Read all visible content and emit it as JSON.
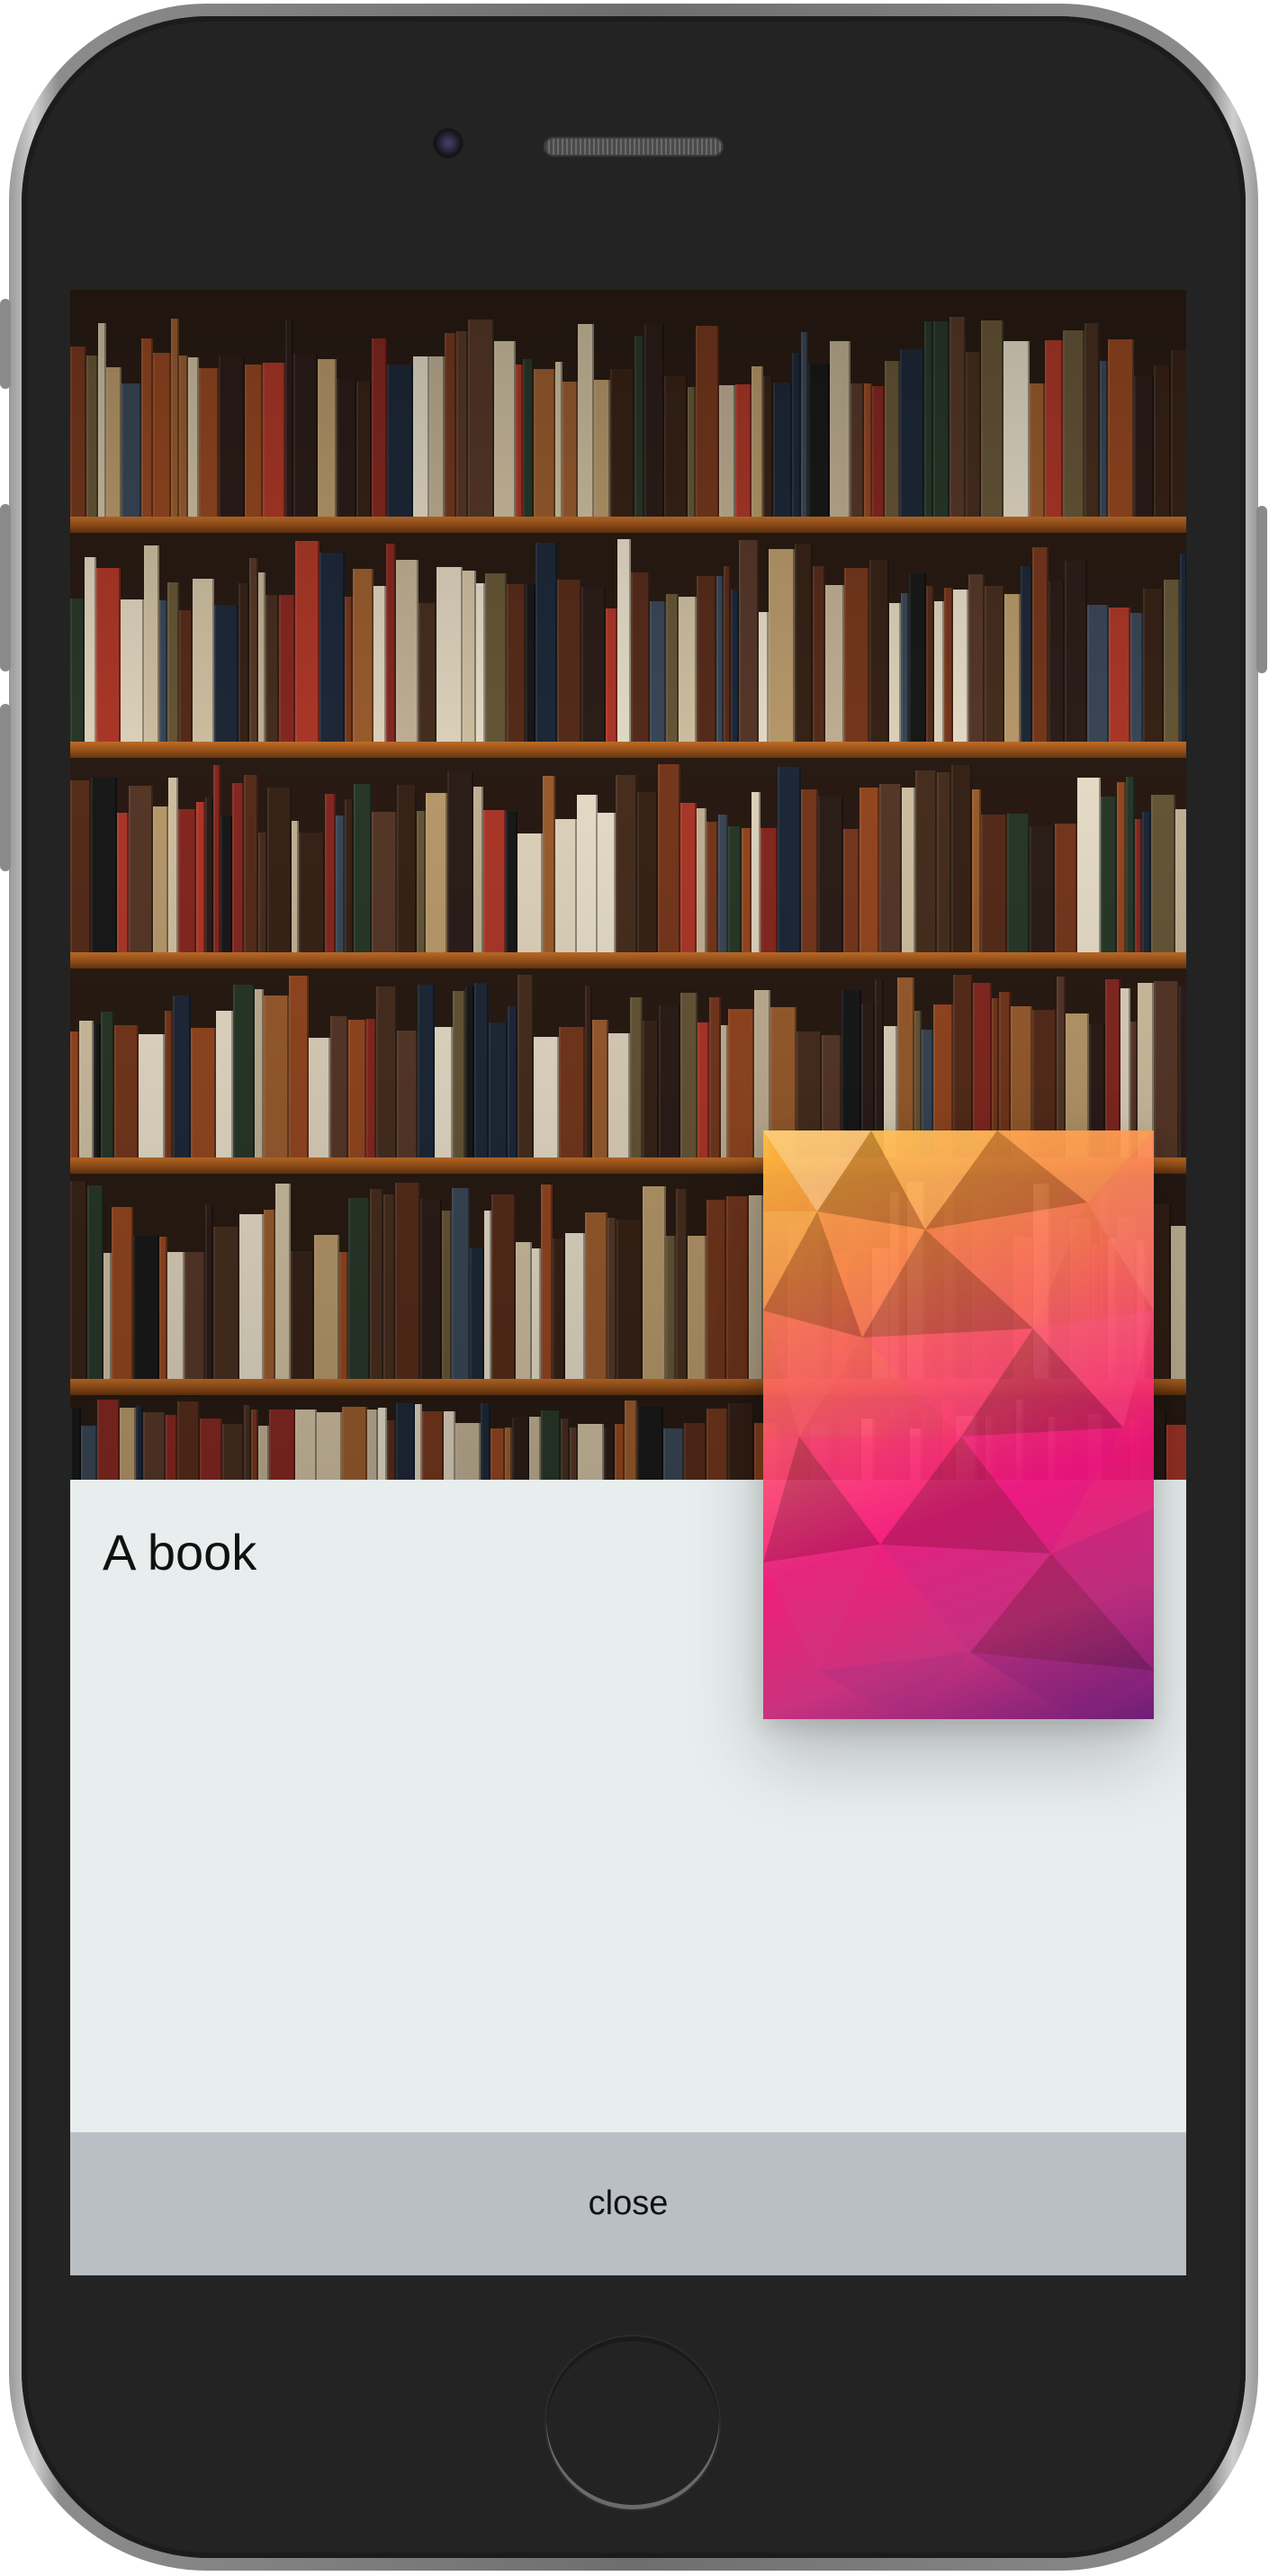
{
  "book": {
    "title": "A book"
  },
  "actions": {
    "close_label": "close"
  },
  "colors": {
    "content_background": "#e8eded",
    "close_bar_background": "#b9bfc5",
    "device_body": "#232323",
    "cover_gradient_start": "#ffbe3c",
    "cover_gradient_mid": "#f01478",
    "cover_gradient_end": "#6e1e78"
  },
  "icons": {
    "hero": "bookshelf-photo",
    "cover": "low-poly-gradient-cover"
  }
}
